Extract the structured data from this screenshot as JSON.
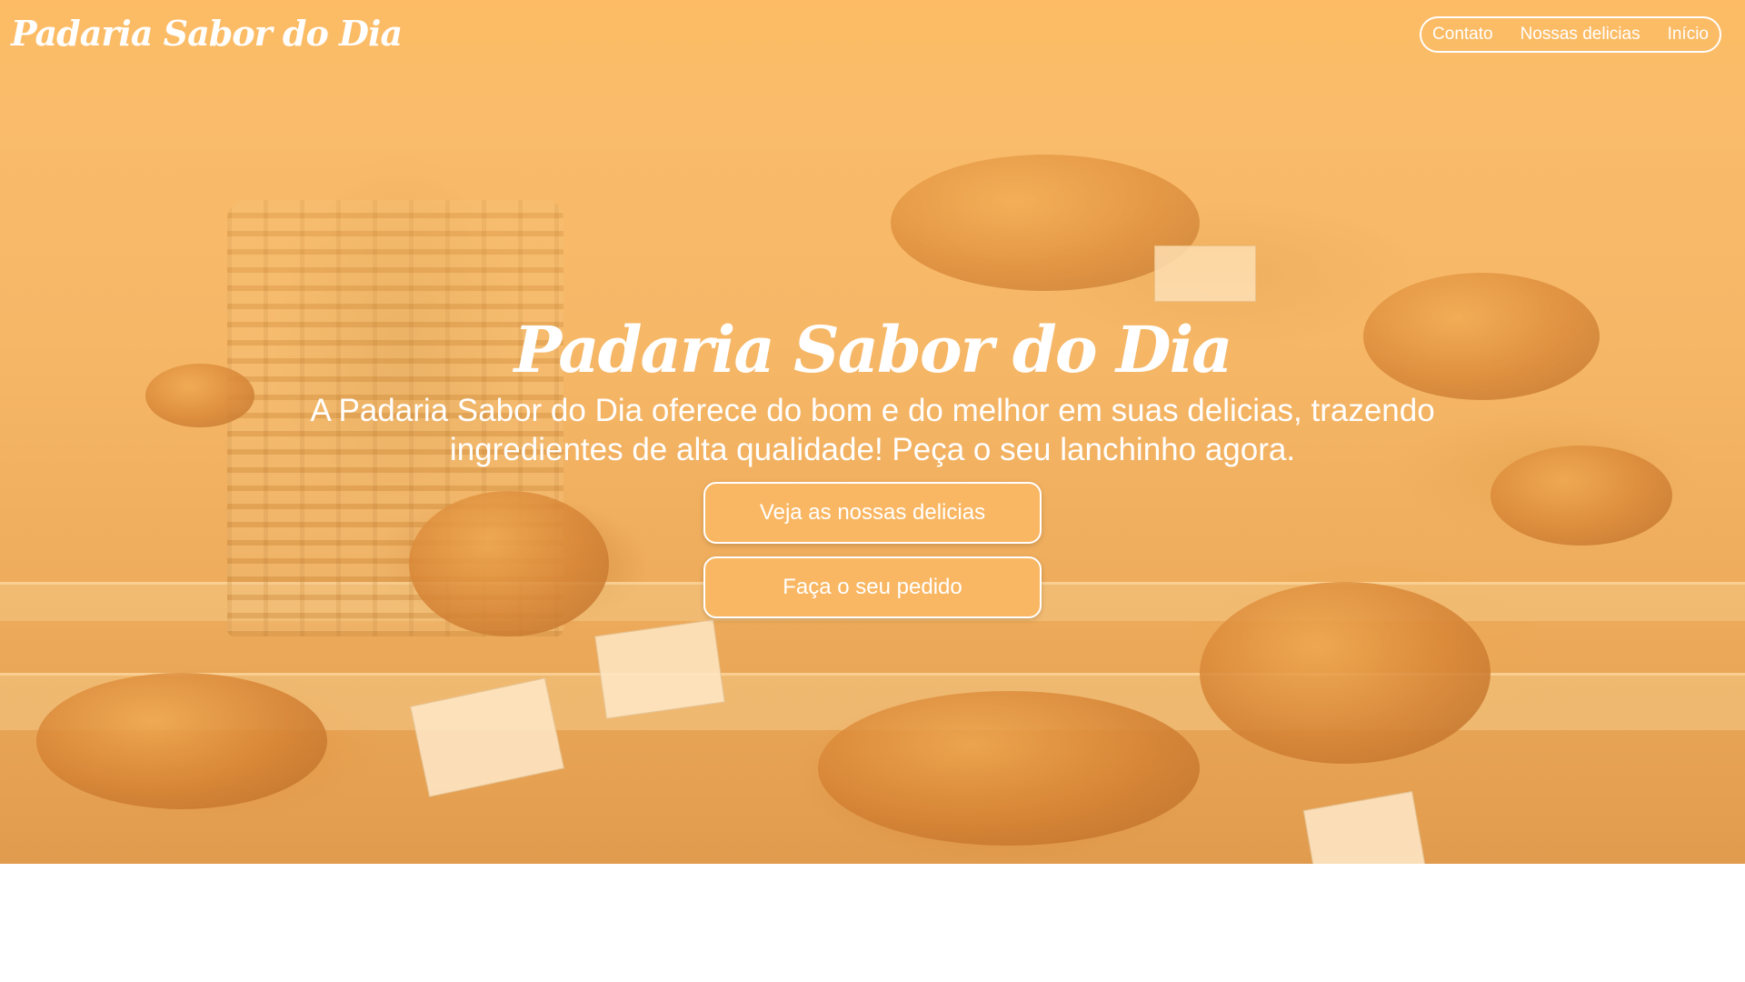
{
  "header": {
    "brand": "Padaria Sabor do Dia",
    "nav": [
      {
        "label": "Contato"
      },
      {
        "label": "Nossas delicias"
      },
      {
        "label": "Início"
      }
    ]
  },
  "hero": {
    "title": "Padaria Sabor do Dia",
    "description": "A Padaria Sabor do Dia oferece do bom e do melhor em suas delicias, trazendo ingredientes de alta qualidade! Peça o seu lanchinho agora.",
    "primary_button": "Veja as nossas delicias",
    "secondary_button": "Faça o seu pedido"
  },
  "colors": {
    "accent": "#f9b763",
    "text": "#ffffff",
    "page_background": "#ffffff"
  }
}
